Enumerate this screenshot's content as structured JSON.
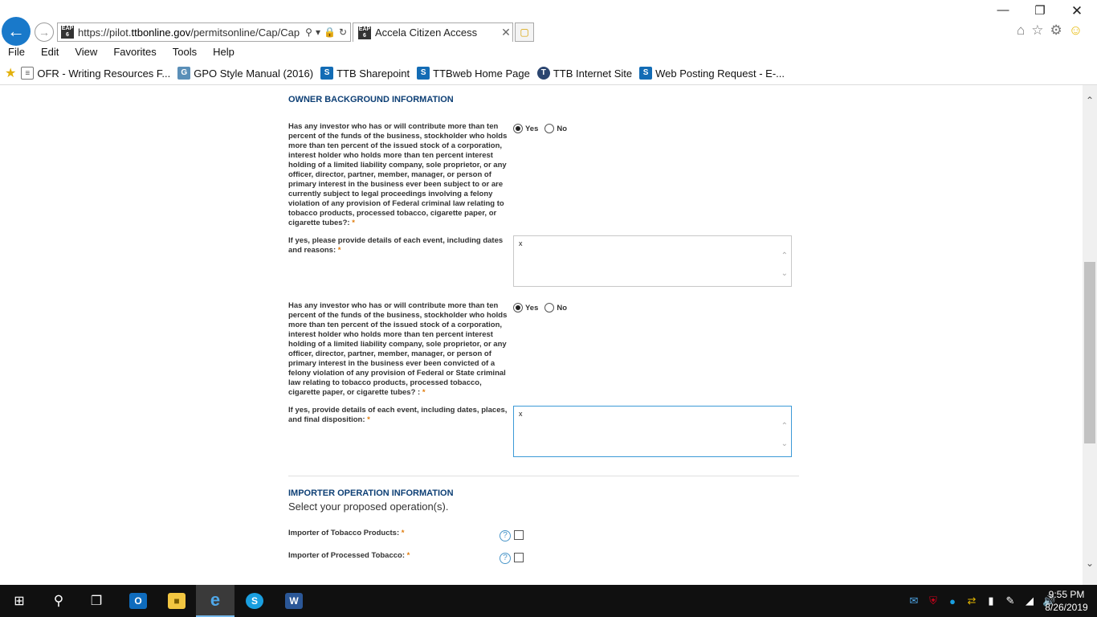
{
  "browser": {
    "url_prefix": "https://pilot.",
    "url_domain": "ttbonline.gov",
    "url_suffix": "/permitsonline/Cap/Cap",
    "site_badge": "EAP 6",
    "tab_title": "Accela Citizen Access",
    "menu": [
      "File",
      "Edit",
      "View",
      "Favorites",
      "Tools",
      "Help"
    ],
    "favorites": [
      {
        "label": "OFR - Writing Resources F...",
        "icon": "document-icon"
      },
      {
        "label": "GPO Style Manual (2016)",
        "icon": "gpo-icon"
      },
      {
        "label": "TTB Sharepoint",
        "icon": "sharepoint-icon"
      },
      {
        "label": "TTBweb Home Page",
        "icon": "sharepoint-icon"
      },
      {
        "label": "TTB Internet Site",
        "icon": "ttb-seal-icon"
      },
      {
        "label": "Web Posting Request - E-...",
        "icon": "sharepoint-icon"
      }
    ]
  },
  "form": {
    "owner_section_title": "OWNER BACKGROUND INFORMATION",
    "q1": {
      "text": "Has any investor who has or will contribute more than ten percent of the funds of the business, stockholder who holds more than ten percent of the issued stock of a corporation, interest holder who holds more than ten percent interest holding of a limited liability company, sole proprietor, or any officer, director, partner, member, manager, or person of primary interest in the business ever been subject to or are currently subject to legal proceedings involving a felony violation of any provision of Federal criminal law relating to tobacco products, processed tobacco, cigarette paper, or cigarette tubes?:",
      "yes_label": "Yes",
      "no_label": "No",
      "selected": "Yes"
    },
    "q1_details": {
      "label": "If yes, please provide details of each event, including dates and reasons:",
      "value": "x"
    },
    "q2": {
      "text": "Has any investor who has or will contribute more than ten percent of the funds of the business, stockholder who holds more than ten percent of the issued stock of a corporation, interest holder who holds more than ten percent interest holding of a limited liability company, sole proprietor, or any officer, director, partner, member, manager, or person of primary interest in the business ever been convicted of a felony violation of any provision of Federal or State criminal law relating to tobacco products, processed tobacco, cigarette paper, or cigarette tubes? :",
      "yes_label": "Yes",
      "no_label": "No",
      "selected": "Yes"
    },
    "q2_details": {
      "label": "If yes, provide details of each event, including dates, places, and final disposition:",
      "value": "x"
    },
    "required_mark": "*",
    "importer_section_title": "IMPORTER OPERATION INFORMATION",
    "importer_subtitle": "Select your proposed operation(s).",
    "importer_tobacco_label": "Importer of Tobacco Products:",
    "importer_processed_label": "Importer of Processed Tobacco:",
    "help_glyph": "?"
  },
  "taskbar": {
    "time": "9:55 PM",
    "date": "8/26/2019"
  }
}
